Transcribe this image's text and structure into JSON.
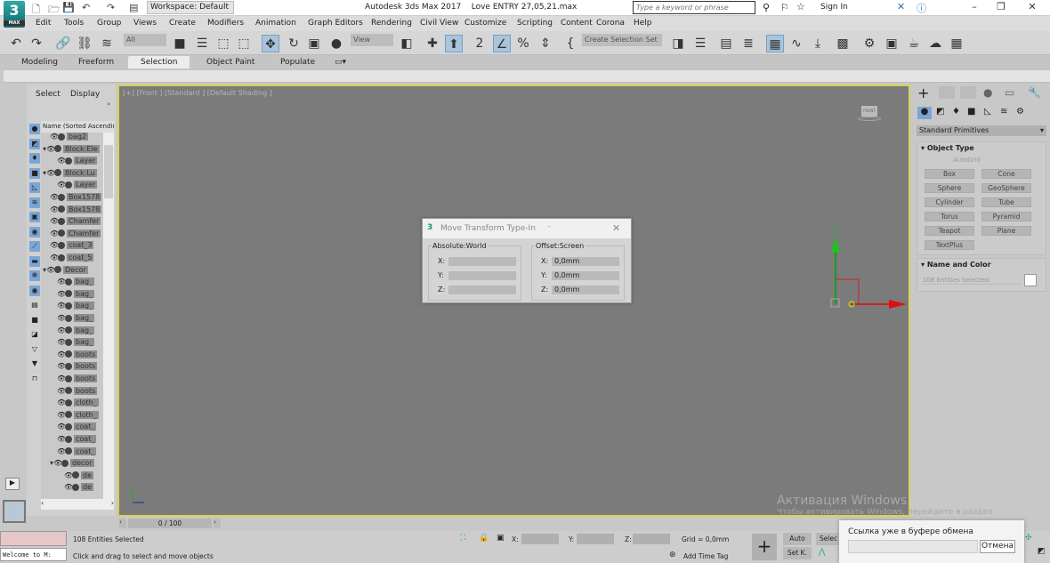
{
  "app": {
    "title": "Autodesk 3ds Max 2017",
    "file": "Love  ENTRY 27,05,21.max",
    "logo": "3",
    "logo_sub": "MAX"
  },
  "workspace": "Workspace: Default",
  "search_placeholder": "Type a keyword or phrase",
  "sign_in": "Sign In",
  "menu": [
    "Edit",
    "Tools",
    "Group",
    "Views",
    "Create",
    "Modifiers",
    "Animation",
    "Graph Editors",
    "Rendering",
    "Civil View",
    "Customize",
    "Scripting",
    "Content",
    "Corona",
    "Help"
  ],
  "toolbar": {
    "filter": "All",
    "ref_coord": "View",
    "selection_set": "Create Selection Set"
  },
  "ribbon_tabs": [
    "Modeling",
    "Freeform",
    "Selection",
    "Object Paint",
    "Populate"
  ],
  "explorer": {
    "tabs": [
      "Select",
      "Display"
    ],
    "column": "Name (Sorted Ascending)",
    "items": [
      "bag2",
      "Block:Ele",
      "Layer",
      "Block:Lu",
      "Layer",
      "Box1578",
      "Box1578",
      "Chamfer",
      "Chamfer",
      "coat_3",
      "coat_5",
      "Decor",
      "bag_",
      "bag_",
      "bag_",
      "bag_",
      "bag_",
      "bag_",
      "boots",
      "boots",
      "boots",
      "boots",
      "cloth_",
      "cloth_",
      "coat_",
      "coat_",
      "coat_",
      "decor",
      "de",
      "de"
    ]
  },
  "viewport": {
    "label": "[+] [Front ] [Standard ] [Default Shading ]",
    "viewcube": "FRONT",
    "gizmo_y": "y"
  },
  "dialog": {
    "title": "Move Transform Type-In",
    "abs_label": "Absolute:World",
    "off_label": "Offset:Screen",
    "axes": [
      "X:",
      "Y:",
      "Z:"
    ],
    "offset_values": [
      "0,0mm",
      "0,0mm",
      "0,0mm"
    ]
  },
  "cmd": {
    "category": "Standard Primitives",
    "object_type": "Object Type",
    "autogrid": "AutoGrid",
    "buttons": [
      "Box",
      "Cone",
      "Sphere",
      "GeoSphere",
      "Cylinder",
      "Tube",
      "Torus",
      "Pyramid",
      "Teapot",
      "Plane",
      "TextPlus"
    ],
    "name_color": "Name and Color",
    "name_value": "108 Entities Selected"
  },
  "timeslider": "0 / 100",
  "status": {
    "selected": "108 Entities Selected",
    "prompt": "Click and drag to select and move objects",
    "maxscript": "Welcome to M:",
    "x": "X:",
    "y": "Y:",
    "z": "Z:",
    "grid": "Grid = 0,0mm",
    "add_time_tag": "Add Time Tag",
    "auto": "Auto",
    "set_key": "Set K.",
    "selected_btn": "Selec"
  },
  "toast": {
    "text": "Ссылка уже в буфере обмена",
    "cancel": "Отмена"
  },
  "watermark": {
    "title": "Активация Windows",
    "sub": "Чтобы активировать Windows, перейдите в раздел"
  }
}
